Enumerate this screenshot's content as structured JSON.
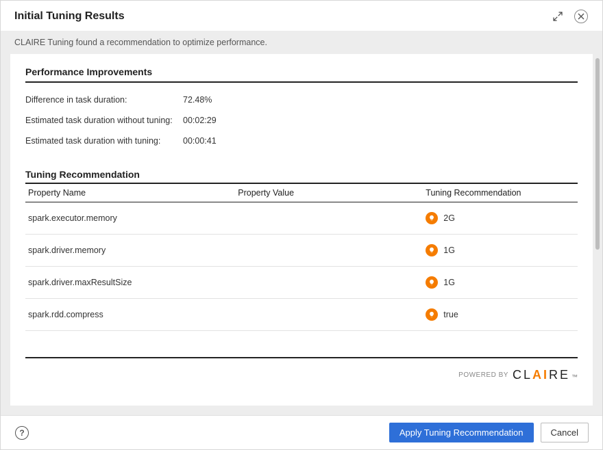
{
  "header": {
    "title": "Initial Tuning Results"
  },
  "subheader": "CLAIRE Tuning found a recommendation to optimize performance.",
  "performance": {
    "section_title": "Performance Improvements",
    "rows": [
      {
        "label": "Difference in task duration:",
        "value": "72.48%"
      },
      {
        "label": "Estimated task duration without tuning:",
        "value": "00:02:29"
      },
      {
        "label": "Estimated task duration with tuning:",
        "value": "00:00:41"
      }
    ]
  },
  "tuning": {
    "section_title": "Tuning Recommendation",
    "columns": {
      "name": "Property Name",
      "value": "Property Value",
      "rec": "Tuning Recommendation"
    },
    "rows": [
      {
        "name": "spark.executor.memory",
        "value": "",
        "rec": "2G"
      },
      {
        "name": "spark.driver.memory",
        "value": "",
        "rec": "1G"
      },
      {
        "name": "spark.driver.maxResultSize",
        "value": "",
        "rec": "1G"
      },
      {
        "name": "spark.rdd.compress",
        "value": "",
        "rec": "true"
      }
    ]
  },
  "branding": {
    "powered_by": "POWERED BY",
    "brand_pre": "CL",
    "brand_mid": "A",
    "brand_i": "I",
    "brand_post": "RE",
    "tm": "™"
  },
  "footer": {
    "apply": "Apply Tuning Recommendation",
    "cancel": "Cancel"
  }
}
